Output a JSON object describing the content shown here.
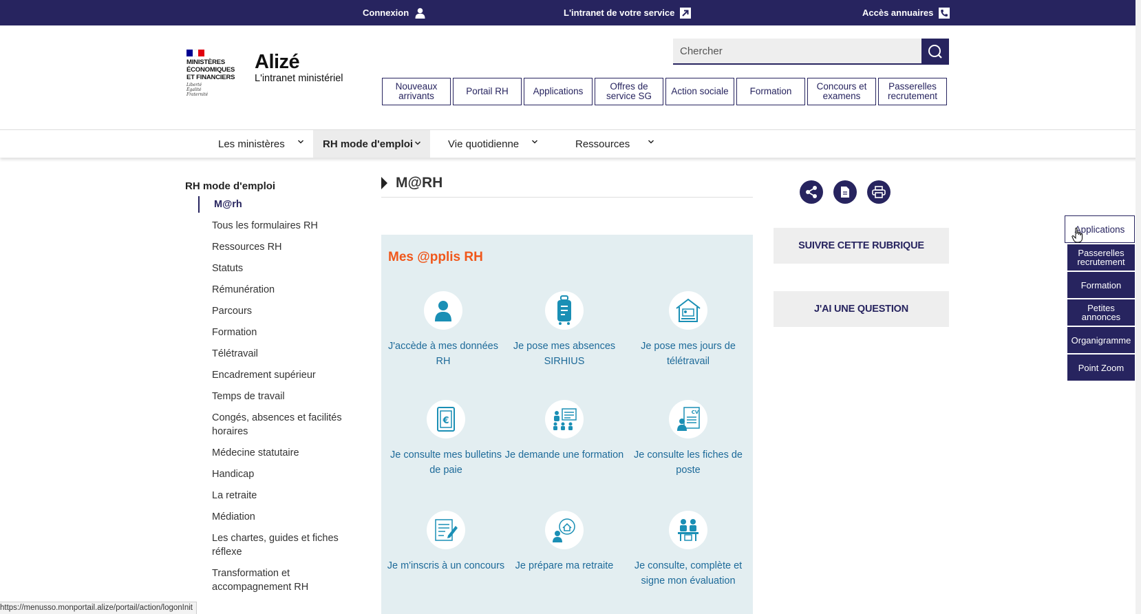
{
  "topbar": {
    "connexion": "Connexion",
    "intranet": "L'intranet de votre service",
    "annuaires": "Accès annuaires"
  },
  "logo": {
    "ministry_line1": "MINISTÈRES",
    "ministry_line2": "ÉCONOMIQUES",
    "ministry_line3": "ET FINANCIERS",
    "motto1": "Liberté",
    "motto2": "Égalité",
    "motto3": "Fraternité",
    "flag_colors": [
      "#000091",
      "#ffffff",
      "#e1000f"
    ]
  },
  "brand": {
    "name": "Alizé",
    "subtitle": "L'intranet ministériel"
  },
  "search": {
    "placeholder": "Chercher"
  },
  "quicklinks": [
    "Nouveaux arrivants",
    "Portail RH",
    "Applications",
    "Offres de service SG",
    "Action sociale",
    "Formation",
    "Concours et examens",
    "Passerelles recrutement"
  ],
  "mainnav": {
    "items": [
      "Les ministères",
      "RH mode d'emploi",
      "Vie quotidienne",
      "Ressources"
    ],
    "active": "RH mode d'emploi"
  },
  "sidebar": {
    "title": "RH mode d'emploi",
    "items": [
      "M@rh",
      "Tous les formulaires RH",
      "Ressources RH",
      "Statuts",
      "Rémunération",
      "Parcours",
      "Formation",
      "Télétravail",
      "Encadrement supérieur",
      "Temps de travail",
      "Congés, absences et facilités horaires",
      "Médecine statutaire",
      "Handicap",
      "La retraite",
      "Médiation",
      "Les chartes, guides et fiches réflexe",
      "Transformation et accompagnement RH"
    ]
  },
  "content": {
    "title": "M@RH",
    "panel_title": "Mes @pplis RH",
    "apps": [
      {
        "label": "J'accède à mes données RH",
        "icon": "user-icon"
      },
      {
        "label": "Je pose mes absences SIRHIUS",
        "icon": "suitcase-icon"
      },
      {
        "label": "Je pose mes jours de télétravail",
        "icon": "home-office-icon"
      },
      {
        "label": "Je consulte mes bulletins de paie",
        "icon": "payslip-icon"
      },
      {
        "label": "Je demande une formation",
        "icon": "training-icon"
      },
      {
        "label": "Je consulte les fiches de poste",
        "icon": "cv-icon"
      },
      {
        "label": "Je m'inscris à un concours",
        "icon": "form-pen-icon"
      },
      {
        "label": "Je prépare ma retraite",
        "icon": "retirement-icon"
      },
      {
        "label": "Je consulte, complète et signe mon évaluation",
        "icon": "meeting-icon"
      }
    ]
  },
  "actions": {
    "follow": "SUIVRE CETTE RUBRIQUE",
    "question": "J'AI UNE QUESTION"
  },
  "float_menu": [
    "Applications",
    "Passerelles recrutement",
    "Formation",
    "Petites annonces",
    "Organigramme",
    "Point Zoom"
  ],
  "statusbar": {
    "url": "https://menusso.monportail.alize/portail/action/logonInit"
  },
  "colors": {
    "primary": "#27245f",
    "accent": "#f0571b",
    "panel": "#e3eef1",
    "app_text": "#1d6a99"
  }
}
